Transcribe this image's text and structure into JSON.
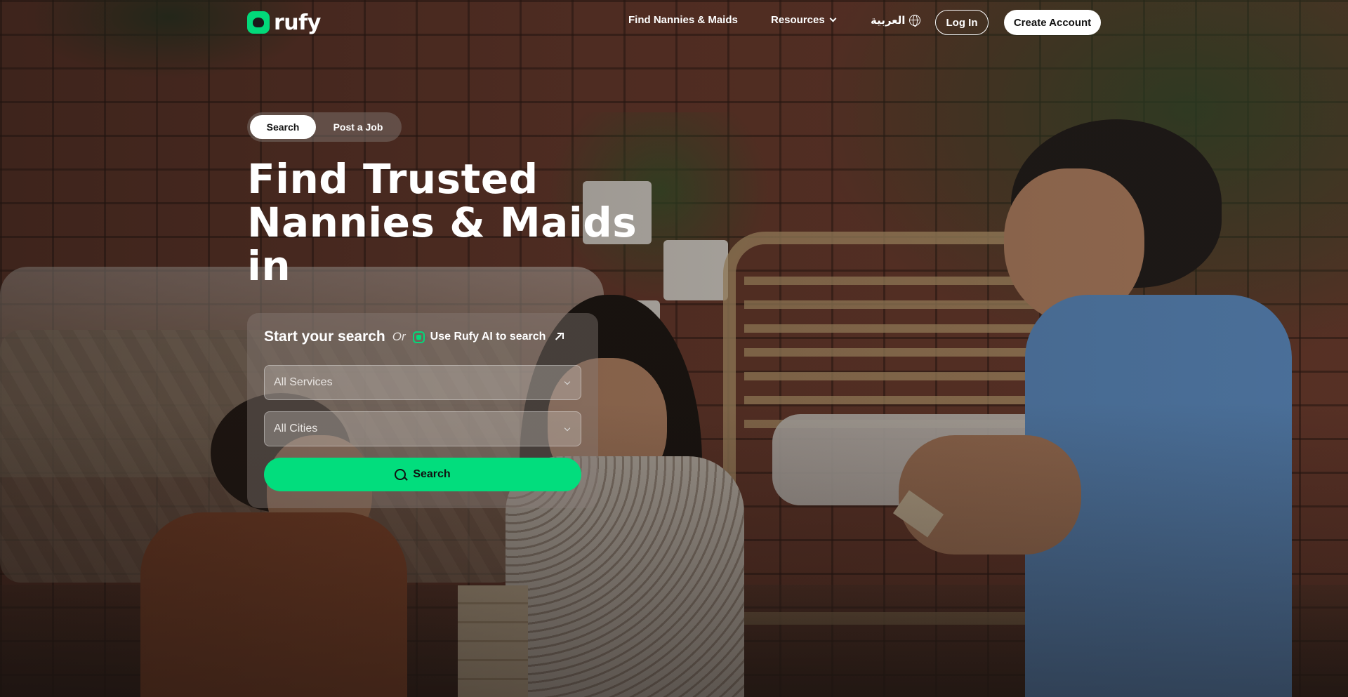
{
  "brand": {
    "name": "rufy",
    "accent_color": "#02dd7d"
  },
  "nav": {
    "find_link": "Find Nannies & Maids",
    "resources_link": "Resources",
    "language_link": "العربية",
    "login_button": "Log In",
    "create_account_button": "Create Account"
  },
  "hero": {
    "tabs": [
      {
        "label": "Search",
        "selected": true
      },
      {
        "label": "Post a Job",
        "selected": false
      }
    ],
    "title_lines": [
      "Find Trusted",
      "Nannies & Maids",
      "in"
    ]
  },
  "search_card": {
    "title": "Start your search",
    "or_text": "Or",
    "ai_link": "Use Rufy AI to search",
    "services_select": {
      "value": "All Services"
    },
    "cities_select": {
      "value": "All Cities"
    },
    "search_button": "Search"
  },
  "icons": {
    "logo": "rufy-logo-icon",
    "resources": "chevron-down-icon",
    "language": "globe-icon",
    "ai": "rufy-ai-icon",
    "external": "arrow-up-right-icon",
    "select": "chevron-down-icon",
    "search": "search-icon"
  }
}
